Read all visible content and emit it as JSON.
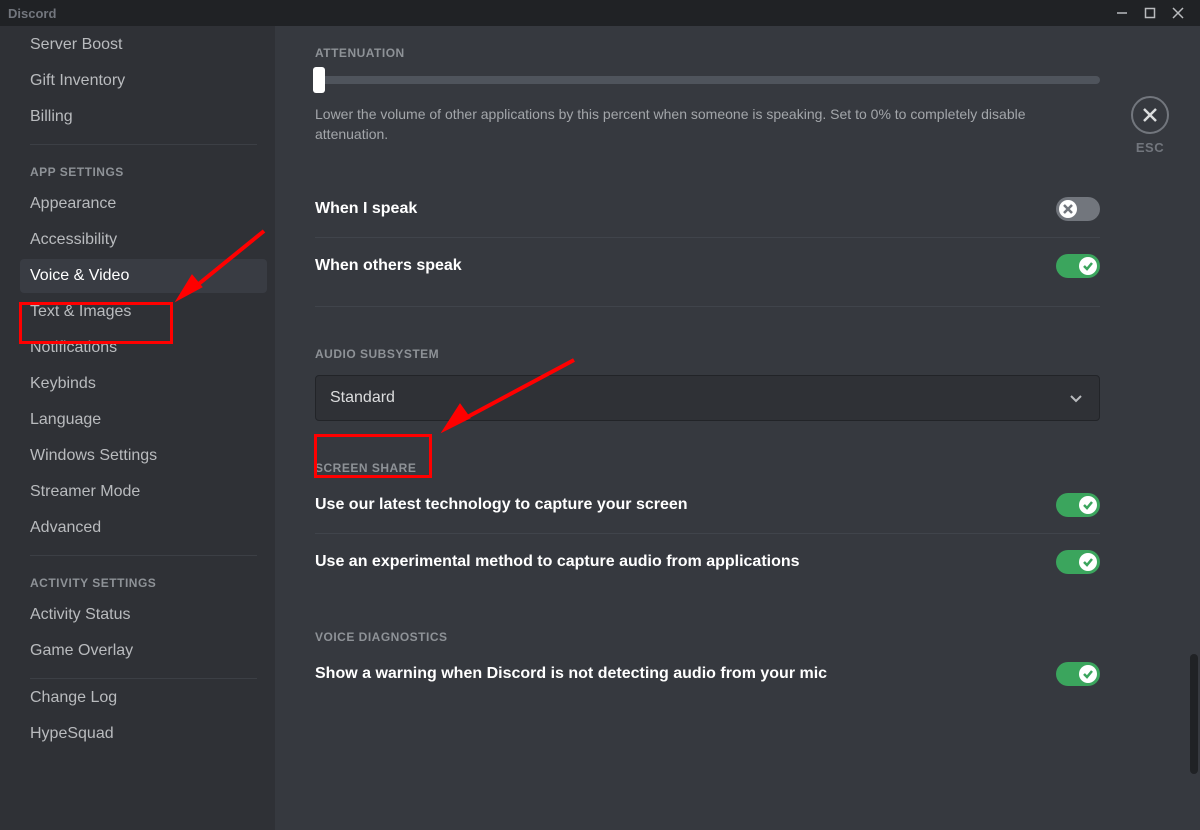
{
  "window": {
    "title": "Discord",
    "esc": "ESC"
  },
  "sidebar": {
    "items_top": [
      "Server Boost",
      "Gift Inventory",
      "Billing"
    ],
    "section_app": "APP SETTINGS",
    "items_app": [
      "Appearance",
      "Accessibility",
      "Voice & Video",
      "Text & Images",
      "Notifications",
      "Keybinds",
      "Language",
      "Windows Settings",
      "Streamer Mode",
      "Advanced"
    ],
    "active_index": 2,
    "section_activity": "ACTIVITY SETTINGS",
    "items_activity": [
      "Activity Status",
      "Game Overlay"
    ],
    "items_bottom": [
      "Change Log",
      "HypeSquad"
    ]
  },
  "attenuation": {
    "title": "ATTENUATION",
    "value_percent": 0,
    "help": "Lower the volume of other applications by this percent when someone is speaking. Set to 0% to completely disable attenuation.",
    "when_i_speak": {
      "label": "When I speak",
      "on": false
    },
    "when_others_speak": {
      "label": "When others speak",
      "on": true
    }
  },
  "audio_subsystem": {
    "title": "AUDIO SUBSYSTEM",
    "selected": "Standard"
  },
  "screen_share": {
    "title": "SCREEN SHARE",
    "latest_tech": {
      "label": "Use our latest technology to capture your screen",
      "on": true
    },
    "experimental_audio": {
      "label": "Use an experimental method to capture audio from applications",
      "on": true
    }
  },
  "voice_diagnostics": {
    "title": "VOICE DIAGNOSTICS",
    "warning": {
      "label": "Show a warning when Discord is not detecting audio from your mic",
      "on": true
    }
  }
}
